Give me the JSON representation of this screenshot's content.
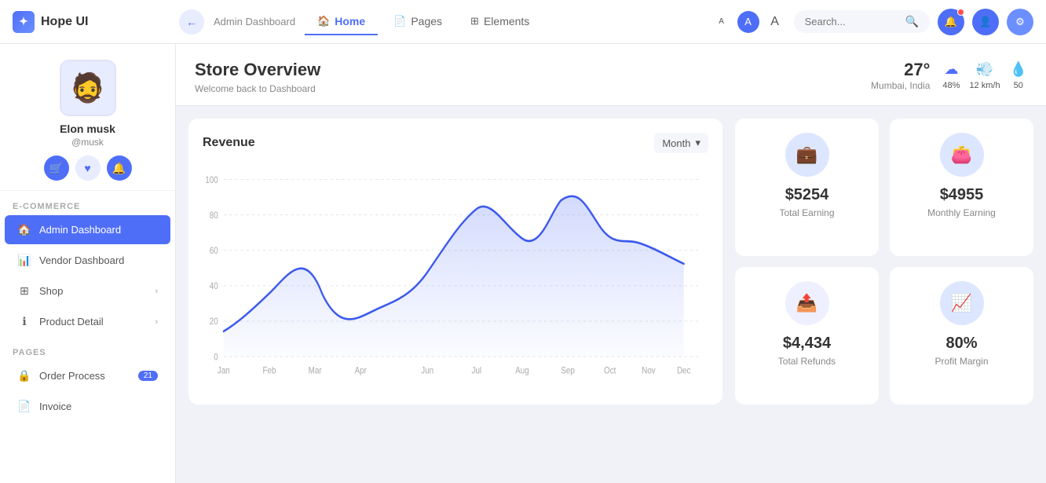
{
  "app": {
    "name": "Hope UI",
    "logo_symbol": "✦"
  },
  "topnav": {
    "back_label": "←",
    "breadcrumb_label": "Admin Dashboard",
    "tabs": [
      {
        "id": "home",
        "label": "Home",
        "icon": "🏠",
        "active": true
      },
      {
        "id": "pages",
        "label": "Pages",
        "icon": "📄",
        "active": false
      },
      {
        "id": "elements",
        "label": "Elements",
        "icon": "⊞",
        "active": false
      }
    ],
    "search_placeholder": "Search...",
    "font_sizes": [
      "A",
      "A",
      "A"
    ],
    "search_label": "Search"
  },
  "sidebar": {
    "profile": {
      "name": "Elon musk",
      "handle": "@musk"
    },
    "profile_actions": [
      "🛒",
      "♥",
      "🔔"
    ],
    "sections": [
      {
        "label": "E-COMMERCE",
        "items": [
          {
            "id": "admin-dashboard",
            "label": "Admin Dashboard",
            "icon": "🏠",
            "active": true
          },
          {
            "id": "vendor-dashboard",
            "label": "Vendor Dashboard",
            "icon": "📊",
            "active": false
          },
          {
            "id": "shop",
            "label": "Shop",
            "icon": "⊞",
            "active": false,
            "has_arrow": true
          },
          {
            "id": "product-detail",
            "label": "Product Detail",
            "icon": "ℹ",
            "active": false,
            "has_arrow": true
          }
        ]
      },
      {
        "label": "PAGES",
        "items": [
          {
            "id": "order-process",
            "label": "Order Process",
            "icon": "🔒",
            "badge": "21",
            "active": false
          },
          {
            "id": "invoice",
            "label": "Invoice",
            "icon": "📄",
            "active": false
          }
        ]
      }
    ]
  },
  "store_overview": {
    "title": "Store Overview",
    "subtitle": "Welcome back to Dashboard",
    "weather": {
      "temp": "27°",
      "location": "Mumbai, India",
      "humidity": "48%",
      "wind": "12 km/h",
      "aqi": "50"
    }
  },
  "revenue_chart": {
    "title": "Revenue",
    "dropdown_label": "Month",
    "x_labels": [
      "Jan",
      "Feb",
      "Mar",
      "Apr",
      "Jun",
      "Jul",
      "Aug",
      "Sep",
      "Oct",
      "Nov",
      "Dec"
    ],
    "y_labels": [
      "100",
      "80",
      "60",
      "40",
      "20",
      "0"
    ]
  },
  "stats": [
    {
      "id": "total-earning",
      "icon": "💼",
      "value": "$5254",
      "label": "Total Earning",
      "icon_color": "blue"
    },
    {
      "id": "monthly-earning",
      "icon": "👛",
      "value": "$4955",
      "label": "Monthly Earning",
      "icon_color": "blue"
    },
    {
      "id": "total-refunds",
      "icon": "📤",
      "value": "$4,434",
      "label": "Total Refunds",
      "icon_color": "light"
    },
    {
      "id": "profit-margin",
      "icon": "📈",
      "value": "80%",
      "label": "Profit Margin",
      "icon_color": "blue"
    }
  ]
}
